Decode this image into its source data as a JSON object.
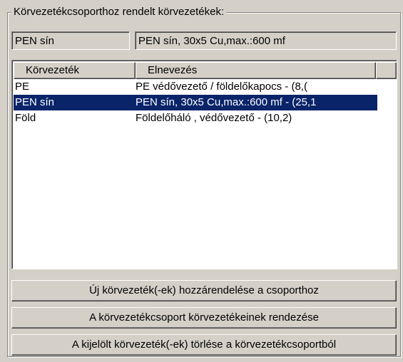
{
  "group": {
    "title": "Körvezetékcsoporthoz rendelt körvezetékek:"
  },
  "selection": {
    "code": "PEN sín",
    "description": "PEN sín, 30x5 Cu,max.:600 mf"
  },
  "list": {
    "columns": [
      "Körvezeték",
      "Elnevezés"
    ],
    "rows": [
      {
        "code": "PE",
        "name": "PE védővezető / földelőkapocs - (8,(",
        "selected": false
      },
      {
        "code": "PEN sín",
        "name": "PEN sín, 30x5 Cu,max.:600 mf - (25,1",
        "selected": true
      },
      {
        "code": "Föld",
        "name": "Földelőháló , védővezető - (10,2)",
        "selected": false
      }
    ]
  },
  "buttons": {
    "add": "Új körvezeték(-ek) hozzárendelése a csoporthoz",
    "sort": "A körvezetékcsoport körvezetékeinek rendezése",
    "delete": "A kijelölt körvezeték(-ek) törlése a körvezetékcsoportból"
  },
  "colors": {
    "selection_bg": "#0a246a",
    "face": "#d4d0c8"
  }
}
